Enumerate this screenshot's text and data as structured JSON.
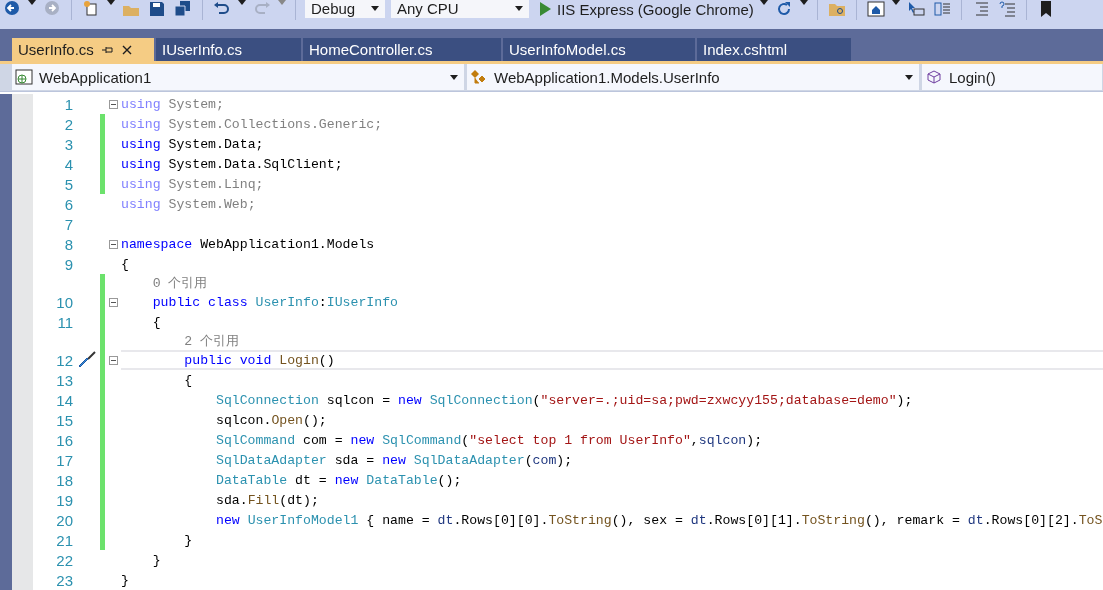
{
  "toolbar": {
    "configuration": "Debug",
    "platform": "Any CPU",
    "run_target": "IIS Express (Google Chrome)"
  },
  "tabs": [
    {
      "label": "UserInfo.cs",
      "selected": true
    },
    {
      "label": "IUserInfo.cs",
      "selected": false
    },
    {
      "label": "HomeController.cs",
      "selected": false
    },
    {
      "label": "UserInfoModel.cs",
      "selected": false
    },
    {
      "label": "Index.cshtml",
      "selected": false
    }
  ],
  "navigation_bar": {
    "project": "WebApplication1",
    "type": "WebApplication1.Models.UserInfo",
    "member": "Login()"
  },
  "editor": {
    "lines": [
      {
        "kind": "code",
        "number": "1",
        "fold": true,
        "changed": false,
        "faded": true,
        "current": false,
        "tokens": [
          {
            "kind": "keyword",
            "text": "using"
          },
          {
            "kind": "plain",
            "text": " System;"
          }
        ]
      },
      {
        "kind": "code",
        "number": "2",
        "fold": false,
        "changed": true,
        "faded": true,
        "current": false,
        "tokens": [
          {
            "kind": "keyword",
            "text": "using"
          },
          {
            "kind": "plain",
            "text": " System.Collections.Generic;"
          }
        ]
      },
      {
        "kind": "code",
        "number": "3",
        "fold": false,
        "changed": true,
        "faded": false,
        "current": false,
        "tokens": [
          {
            "kind": "keyword",
            "text": "using"
          },
          {
            "kind": "plain",
            "text": " System.Data;"
          }
        ]
      },
      {
        "kind": "code",
        "number": "4",
        "fold": false,
        "changed": true,
        "faded": false,
        "current": false,
        "tokens": [
          {
            "kind": "keyword",
            "text": "using"
          },
          {
            "kind": "plain",
            "text": " System.Data.SqlClient;"
          }
        ]
      },
      {
        "kind": "code",
        "number": "5",
        "fold": false,
        "changed": true,
        "faded": true,
        "current": false,
        "tokens": [
          {
            "kind": "keyword",
            "text": "using"
          },
          {
            "kind": "plain",
            "text": " System.Linq;"
          }
        ]
      },
      {
        "kind": "code",
        "number": "6",
        "fold": false,
        "changed": false,
        "faded": true,
        "current": false,
        "tokens": [
          {
            "kind": "keyword",
            "text": "using"
          },
          {
            "kind": "plain",
            "text": " System.Web;"
          }
        ]
      },
      {
        "kind": "code",
        "number": "7",
        "fold": false,
        "changed": false,
        "current": false
      },
      {
        "kind": "code",
        "number": "8",
        "fold": true,
        "changed": false,
        "faded": false,
        "current": false,
        "tokens": [
          {
            "kind": "keyword",
            "text": "namespace"
          },
          {
            "kind": "plain",
            "text": " WebApplication1.Models"
          }
        ]
      },
      {
        "kind": "code",
        "number": "9",
        "fold": false,
        "changed": false,
        "faded": false,
        "current": false,
        "tokens": [
          {
            "kind": "plain",
            "text": "{"
          }
        ]
      },
      {
        "kind": "lens",
        "changed": true,
        "text": "    0 个引用"
      },
      {
        "kind": "code",
        "number": "10",
        "fold": true,
        "changed": true,
        "faded": false,
        "current": false,
        "tokens": [
          {
            "kind": "keyword",
            "text": "    public"
          },
          {
            "kind": "keyword",
            "text": " class"
          },
          {
            "kind": "type",
            "text": " UserInfo"
          },
          {
            "kind": "plain",
            "text": ":"
          },
          {
            "kind": "type",
            "text": "IUserInfo"
          }
        ]
      },
      {
        "kind": "code",
        "number": "11",
        "fold": false,
        "changed": true,
        "faded": false,
        "current": false,
        "tokens": [
          {
            "kind": "plain",
            "text": "    {"
          }
        ]
      },
      {
        "kind": "lens",
        "changed": true,
        "text": "        2 个引用"
      },
      {
        "kind": "code",
        "number": "12",
        "fold": true,
        "changed": true,
        "faded": false,
        "current": true,
        "tokens": [
          {
            "kind": "keyword",
            "text": "        public"
          },
          {
            "kind": "keyword",
            "text": " void"
          },
          {
            "kind": "method",
            "text": " Login"
          },
          {
            "kind": "plain",
            "text": "()"
          }
        ]
      },
      {
        "kind": "code",
        "number": "13",
        "fold": false,
        "changed": true,
        "faded": false,
        "current": false,
        "tokens": [
          {
            "kind": "plain",
            "text": "        {"
          }
        ]
      },
      {
        "kind": "code",
        "number": "14",
        "fold": false,
        "changed": true,
        "faded": false,
        "current": false,
        "tokens": [
          {
            "kind": "type",
            "text": "            SqlConnection"
          },
          {
            "kind": "plain",
            "text": " sqlcon = "
          },
          {
            "kind": "keyword",
            "text": "new"
          },
          {
            "kind": "type",
            "text": " SqlConnection"
          },
          {
            "kind": "plain",
            "text": "("
          },
          {
            "kind": "string",
            "text": "\"server=.;uid=sa;pwd=zxwcyy155;database=demo\""
          },
          {
            "kind": "plain",
            "text": ");"
          }
        ]
      },
      {
        "kind": "code",
        "number": "15",
        "fold": false,
        "changed": true,
        "faded": false,
        "current": false,
        "tokens": [
          {
            "kind": "plain",
            "text": "            sqlcon."
          },
          {
            "kind": "method",
            "text": "Open"
          },
          {
            "kind": "plain",
            "text": "();"
          }
        ]
      },
      {
        "kind": "code",
        "number": "16",
        "fold": false,
        "changed": true,
        "faded": false,
        "current": false,
        "tokens": [
          {
            "kind": "type",
            "text": "            SqlCommand"
          },
          {
            "kind": "plain",
            "text": " com = "
          },
          {
            "kind": "keyword",
            "text": "new"
          },
          {
            "kind": "type",
            "text": " SqlCommand"
          },
          {
            "kind": "plain",
            "text": "("
          },
          {
            "kind": "string",
            "text": "\"select top 1 from UserInfo\""
          },
          {
            "kind": "plain",
            "text": ","
          },
          {
            "kind": "variable",
            "text": "sqlcon"
          },
          {
            "kind": "plain",
            "text": ");"
          }
        ]
      },
      {
        "kind": "code",
        "number": "17",
        "fold": false,
        "changed": true,
        "faded": false,
        "current": false,
        "tokens": [
          {
            "kind": "type",
            "text": "            SqlDataAdapter"
          },
          {
            "kind": "plain",
            "text": " sda = "
          },
          {
            "kind": "keyword",
            "text": "new"
          },
          {
            "kind": "type",
            "text": " SqlDataAdapter"
          },
          {
            "kind": "plain",
            "text": "("
          },
          {
            "kind": "variable",
            "text": "com"
          },
          {
            "kind": "plain",
            "text": ");"
          }
        ]
      },
      {
        "kind": "code",
        "number": "18",
        "fold": false,
        "changed": true,
        "faded": false,
        "current": false,
        "tokens": [
          {
            "kind": "type",
            "text": "            DataTable"
          },
          {
            "kind": "plain",
            "text": " dt = "
          },
          {
            "kind": "keyword",
            "text": "new"
          },
          {
            "kind": "type",
            "text": " DataTable"
          },
          {
            "kind": "plain",
            "text": "();"
          }
        ]
      },
      {
        "kind": "code",
        "number": "19",
        "fold": false,
        "changed": true,
        "faded": false,
        "current": false,
        "tokens": [
          {
            "kind": "plain",
            "text": "            sda."
          },
          {
            "kind": "method",
            "text": "Fill"
          },
          {
            "kind": "plain",
            "text": "(dt);"
          }
        ]
      },
      {
        "kind": "code",
        "number": "20",
        "fold": false,
        "changed": true,
        "faded": false,
        "current": false,
        "tokens": [
          {
            "kind": "keyword",
            "text": "            new"
          },
          {
            "kind": "type",
            "text": " UserInfoModel1"
          },
          {
            "kind": "plain",
            "text": " { name = "
          },
          {
            "kind": "variable",
            "text": "dt"
          },
          {
            "kind": "plain",
            "text": ".Rows[0][0]."
          },
          {
            "kind": "method",
            "text": "ToString"
          },
          {
            "kind": "plain",
            "text": "(), sex = "
          },
          {
            "kind": "variable",
            "text": "dt"
          },
          {
            "kind": "plain",
            "text": ".Rows[0][1]."
          },
          {
            "kind": "method",
            "text": "ToString"
          },
          {
            "kind": "plain",
            "text": "(), remark = "
          },
          {
            "kind": "variable",
            "text": "dt"
          },
          {
            "kind": "plain",
            "text": ".Rows[0][2]."
          },
          {
            "kind": "method",
            "text": "ToS"
          }
        ]
      },
      {
        "kind": "code",
        "number": "21",
        "fold": false,
        "changed": true,
        "faded": false,
        "current": false,
        "tokens": [
          {
            "kind": "plain",
            "text": "        }"
          }
        ]
      },
      {
        "kind": "code",
        "number": "22",
        "fold": false,
        "changed": false,
        "faded": false,
        "current": false,
        "tokens": [
          {
            "kind": "plain",
            "text": "    }"
          }
        ]
      },
      {
        "kind": "code",
        "number": "23",
        "fold": false,
        "changed": false,
        "faded": false,
        "current": false,
        "tokens": [
          {
            "kind": "plain",
            "text": "}"
          }
        ]
      }
    ]
  }
}
